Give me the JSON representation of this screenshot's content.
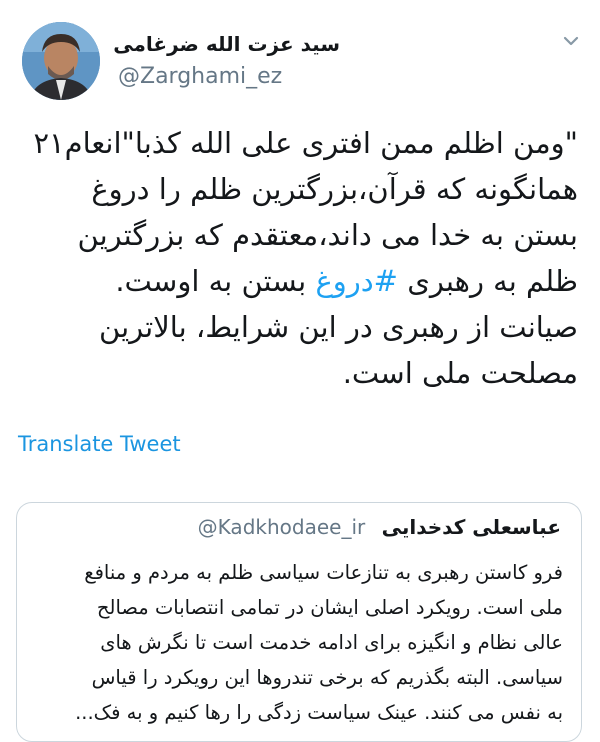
{
  "author": {
    "display_name": "سید عزت الله ضرغامی",
    "handle": "@Zarghami_ez",
    "avatar": "avatar-photo"
  },
  "tweet": {
    "text_before_hashtag": "\"ومن اظلم ممن افتری علی الله کذبا\"انعام۲۱\nهمانگونه که قرآن،بزرگترین ظلم را دروغ\nبستن به خدا می داند،معتقدم که بزرگترین\nظلم به رهبری ",
    "hashtag": "#دروغ",
    "text_after_hashtag": " بستن به اوست.\nصیانت از رهبری در این شرایط، بالاترین\nمصلحت ملی است."
  },
  "translate_label": "Translate Tweet",
  "quoted": {
    "display_name": "عباسعلی کدخدایی",
    "handle": "@Kadkhodaee_ir",
    "text": "فرو کاستن رهبری به تنازعات سیاسی ظلم به مردم و منافع\nملی است. رویکرد اصلی ایشان در تمامی انتصابات مصالح\nعالی نظام و انگیزه برای ادامه خدمت است تا نگرش های\nسیاسی. البته بگذریم که برخی تندروها این رویکرد را قیاس\nبه نفس می کنند. عینک سیاست زدگی را رها کنیم و به فک..."
  },
  "icons": {
    "menu": "chevron-down-icon"
  },
  "colors": {
    "link": "#1b95e0",
    "hashtag": "#1da1f2",
    "muted": "#657786",
    "border": "#ccd6dd"
  }
}
